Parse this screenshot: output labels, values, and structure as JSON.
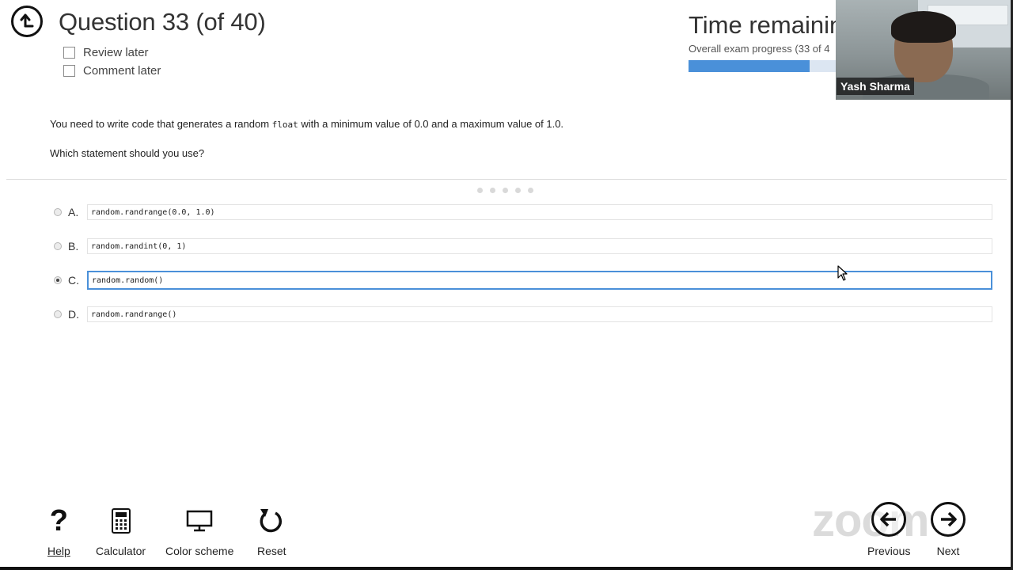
{
  "header": {
    "question_title": "Question 33 (of 40)",
    "review_later": "Review later",
    "comment_later": "Comment later",
    "time_title": "Time remainin",
    "progress_label": "Overall exam progress (33 of 4",
    "progress_fraction": 0.825
  },
  "video": {
    "participant_name": "Yash Sharma"
  },
  "question": {
    "stem_before": "You need to write code that generates a random ",
    "stem_code": "float",
    "stem_after": " with a minimum value of 0.0 and a maximum value of 1.0.",
    "ask": "Which statement should you use?"
  },
  "options": [
    {
      "letter": "A.",
      "code": "random.randrange(0.0, 1.0)",
      "selected": false
    },
    {
      "letter": "B.",
      "code": "random.randint(0, 1)",
      "selected": false
    },
    {
      "letter": "C.",
      "code": "random.random()",
      "selected": true
    },
    {
      "letter": "D.",
      "code": "random.randrange()",
      "selected": false
    }
  ],
  "toolbar": {
    "help": "Help",
    "calculator": "Calculator",
    "color_scheme": "Color scheme",
    "reset": "Reset",
    "previous": "Previous",
    "next": "Next"
  },
  "watermark": "zoom",
  "colors": {
    "accent": "#4a90d9",
    "progress_track": "#dce6f2"
  }
}
